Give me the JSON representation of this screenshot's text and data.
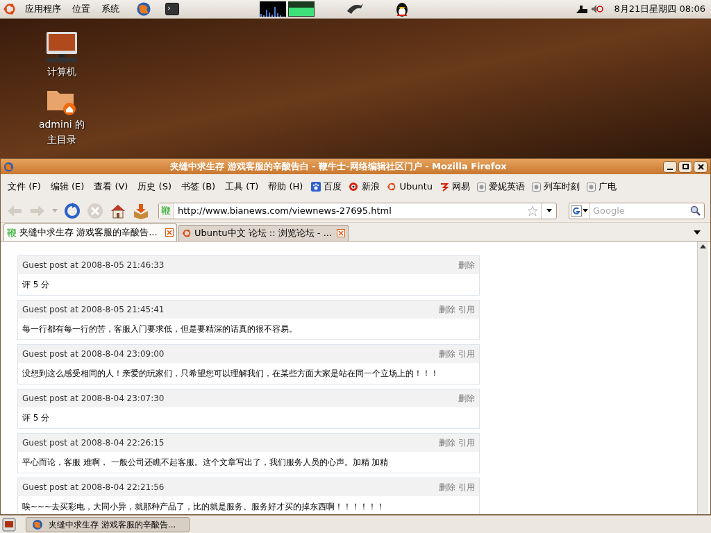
{
  "top_panel": {
    "menus": [
      "应用程序",
      "位置",
      "系统"
    ],
    "clock": "8月21日星期四 08:06"
  },
  "desktop": {
    "icons": [
      {
        "kind": "computer",
        "label": "计算机"
      },
      {
        "kind": "home",
        "lines": [
          "admini 的",
          "主目录"
        ]
      }
    ]
  },
  "window": {
    "title": "夹缝中求生存 游戏客服的辛酸告白 - 鞭牛士-网络编辑社区门户 - Mozilla Firefox"
  },
  "menu_bar": [
    "文件 (F)",
    "编辑 (E)",
    "查看 (V)",
    "历史 (S)",
    "书签 (B)",
    "工具 (T)",
    "帮助 (H)"
  ],
  "bookmarks": [
    {
      "kind": "paw",
      "label": "百度"
    },
    {
      "kind": "eye",
      "label": "新浪"
    },
    {
      "kind": "ubuntu",
      "label": "Ubuntu"
    },
    {
      "kind": "netease",
      "label": "网易"
    },
    {
      "kind": "feed",
      "label": "爱妮英语"
    },
    {
      "kind": "feed",
      "label": "列车时刻"
    },
    {
      "kind": "feed",
      "label": "广电"
    }
  ],
  "address_bar": {
    "site_mark": "鞭",
    "value": "http://www.bianews.com/viewnews-27695.html"
  },
  "search": {
    "placeholder": "Google"
  },
  "tabs": [
    {
      "kind": "site",
      "mark": "鞭",
      "label": "夹缝中求生存 游戏客服的辛酸告...",
      "selected": true
    },
    {
      "kind": "ubuntu",
      "label": "Ubuntu中文 论坛 :: 浏览论坛 - ...",
      "selected": false
    }
  ],
  "comments": [
    {
      "header": "Guest post at 2008-8-05 21:46:33",
      "actions": [
        "删除"
      ],
      "body": "评 5 分"
    },
    {
      "header": "Guest post at 2008-8-05 21:45:41",
      "actions": [
        "删除",
        "引用"
      ],
      "body": "每一行都有每一行的苦，客服入门要求低，但是要精深的话真的很不容易。"
    },
    {
      "header": "Guest post at 2008-8-04 23:09:00",
      "actions": [
        "删除",
        "引用"
      ],
      "body": "没想到这么感受相同的人！亲爱的玩家们，只希望您可以理解我们，在某些方面大家是站在同一个立场上的！！！"
    },
    {
      "header": "Guest post at 2008-8-04 23:07:30",
      "actions": [
        "删除"
      ],
      "body": "评 5 分"
    },
    {
      "header": "Guest post at 2008-8-04 22:26:15",
      "actions": [
        "删除",
        "引用"
      ],
      "body": "平心而论，客服 难啊， 一般公司还瞧不起客服。这个文章写出了，我们服务人员的心声。加精 加精"
    },
    {
      "header": "Guest post at 2008-8-04 22:21:56",
      "actions": [
        "删除",
        "引用"
      ],
      "body": "唉~~~去买彩电，大同小异，就那种产品了，比的就是服务。服务好才买的掉东西啊！！！！！！"
    }
  ],
  "taskbar": [
    {
      "label": "夹缝中求生存 游戏客服的辛酸告...",
      "selected": true
    }
  ]
}
